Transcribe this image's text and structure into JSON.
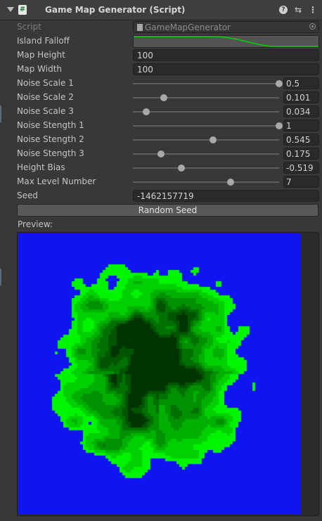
{
  "component": {
    "title": "Game Map Generator (Script)",
    "script_icon_glyph": "#",
    "icons": {
      "foldout": "foldout-arrow-icon",
      "script": "script-icon",
      "help": "help-icon",
      "presets": "presets-icon",
      "menu": "kebab-menu-icon"
    },
    "help_glyph": "?",
    "presets_glyph": "⇆",
    "menu_glyph": "⋮"
  },
  "fields": {
    "script_label": "Script",
    "script_value": "GameMapGenerator",
    "falloff_label": "Island Falloff",
    "map_height_label": "Map Height",
    "map_height_value": "100",
    "map_width_label": "Map Width",
    "map_width_value": "100"
  },
  "sliders": [
    {
      "label": "Noise Scale 1",
      "value": "0.5",
      "fraction": 1.0
    },
    {
      "label": "Noise Scale 2",
      "value": "0.101",
      "fraction": 0.21
    },
    {
      "label": "Noise Scale 3",
      "value": "0.034",
      "fraction": 0.09
    },
    {
      "label": "Noise Stength 1",
      "value": "1",
      "fraction": 1.0
    },
    {
      "label": "Noise Stength 2",
      "value": "0.545",
      "fraction": 0.55
    },
    {
      "label": "Noise Stength 3",
      "value": "0.175",
      "fraction": 0.19
    },
    {
      "label": "Height Bias",
      "value": "-0.519",
      "fraction": 0.33
    },
    {
      "label": "Max Level Number",
      "value": "7",
      "fraction": 0.67
    }
  ],
  "seed": {
    "label": "Seed",
    "value": "-1462157719"
  },
  "random_seed_button": "Random Seed",
  "preview": {
    "label": "Preview:",
    "colors": {
      "water": "#0f14f0",
      "land_0": "#00f500",
      "land_1": "#00d000",
      "land_2": "#00b000",
      "land_3": "#009000",
      "land_4": "#007000",
      "land_5": "#005400",
      "land_6": "#003400"
    }
  },
  "colors": {
    "panel_bg": "#383838",
    "curve_line": "#00d400",
    "accent_strip": "#566b7e"
  }
}
